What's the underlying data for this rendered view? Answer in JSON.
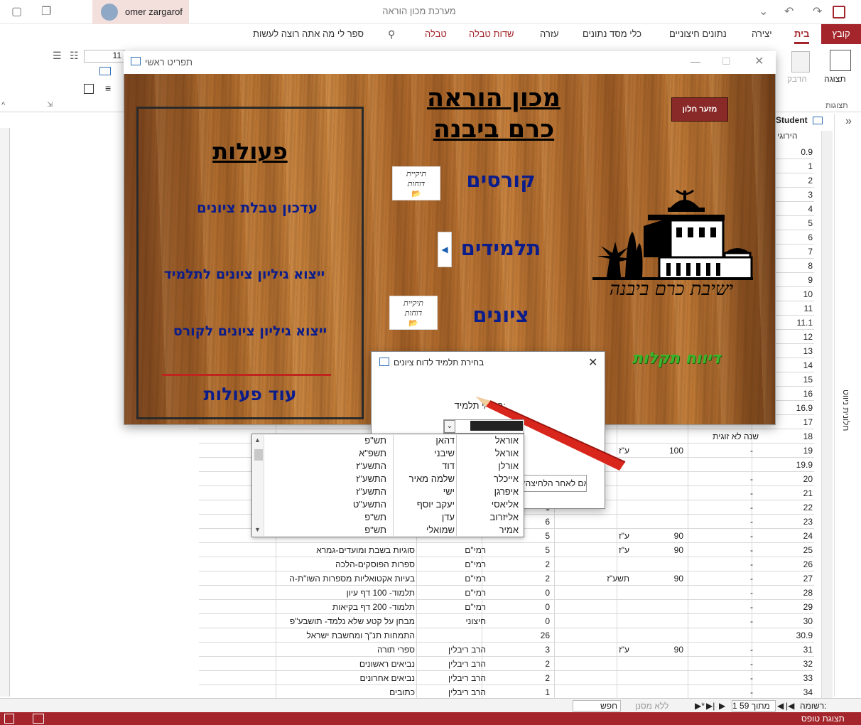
{
  "app": {
    "title": "מערכת מכון הוראה",
    "user": "omer zargarof",
    "file_tab": "קובץ",
    "tabs": [
      "בית",
      "יצירה",
      "נתונים חיצוניים",
      "כלי מסד נתונים",
      "עזרה",
      "שדות טבלה",
      "טבלה"
    ],
    "search_hint": "ספר לי מה אתה רוצה לעשות"
  },
  "ribbon": {
    "views_label": "תצוגה",
    "views_group": "תצוגות",
    "paste_label": "הדבק",
    "font_size": "11"
  },
  "table": {
    "tab_name": "Student",
    "col_head": "הירוגי",
    "rows": [
      {
        "id": "0.9"
      },
      {
        "id": "1"
      },
      {
        "id": "2"
      },
      {
        "id": "3"
      },
      {
        "id": "4"
      },
      {
        "id": "5"
      },
      {
        "id": "6"
      },
      {
        "id": "7"
      },
      {
        "id": "8"
      },
      {
        "id": "9"
      },
      {
        "id": "10"
      },
      {
        "id": "11"
      },
      {
        "id": "11.1"
      },
      {
        "id": "12"
      },
      {
        "id": "13"
      },
      {
        "id": "14"
      },
      {
        "id": "15"
      },
      {
        "id": "16"
      },
      {
        "id": "16.9"
      },
      {
        "id": "17"
      },
      {
        "id": "18",
        "a": "שנה לא זוגית"
      },
      {
        "id": "19",
        "b": "-",
        "c": "100",
        "d": "ע\"ז"
      },
      {
        "id": "19.9"
      },
      {
        "id": "20",
        "b": "-"
      },
      {
        "id": "21",
        "b": "-"
      },
      {
        "id": "22",
        "b": "-",
        "e": "1"
      },
      {
        "id": "23",
        "b": "-",
        "e": "6"
      },
      {
        "id": "24",
        "b": "-",
        "c": "90",
        "d": "ע\"ז",
        "e": "5"
      },
      {
        "id": "25",
        "b": "-",
        "c": "90",
        "d": "ע\"ז",
        "e": "5",
        "f": "רמי\"ם",
        "g": "סוגיות בשבת ומועדים-גמרא"
      },
      {
        "id": "26",
        "b": "-",
        "e": "2",
        "f": "רמי\"ם",
        "g": "ספרות הפוסקים-הלכה"
      },
      {
        "id": "27",
        "b": "-",
        "c": "90",
        "d": "תשע\"ז",
        "e": "2",
        "f": "רמי\"ם",
        "g": "בעיות אקטואליות מספרות השו\"ת-ה"
      },
      {
        "id": "28",
        "b": "-",
        "e": "0",
        "f": "רמי\"ם",
        "g": "תלמוד- 100 דף עיון"
      },
      {
        "id": "29",
        "b": "-",
        "e": "0",
        "f": "רמי\"ם",
        "g": "תלמוד- 200 דף בקיאות"
      },
      {
        "id": "30",
        "b": "-",
        "e": "0",
        "f": "חיצוני",
        "g": "מבחן על קטע שלא נלמד- תושבע\"פ"
      },
      {
        "id": "30.9",
        "e": "26",
        "g": "התמחות תנ\"ך ומחשבת ישראל"
      },
      {
        "id": "31",
        "b": "-",
        "c": "90",
        "d": "ע\"ז",
        "e": "3",
        "f": "הרב ריבלין",
        "g": "ספרי תורה"
      },
      {
        "id": "32",
        "b": "-",
        "e": "2",
        "f": "הרב ריבלין",
        "g": "נביאים ראשונים"
      },
      {
        "id": "33",
        "b": "-",
        "e": "2",
        "f": "הרב ריבלין",
        "g": "נביאים אחרונים"
      },
      {
        "id": "34",
        "b": "-",
        "e": "1",
        "f": "הרב ריבלין",
        "g": "כתובים"
      }
    ]
  },
  "record_nav": {
    "label": "רשומה:",
    "position": "1 מתוך 59",
    "filter": "ללא מסנן",
    "search": "חפש"
  },
  "status": {
    "text": "תצוגת טופס"
  },
  "nav_pane": {
    "label": "חלונית ניווט"
  },
  "form": {
    "title": "תפריט ראשי",
    "actions_title": "פעולות",
    "action_update_grades": "עדכון טבלת ציונים",
    "action_export_student": "ייצוא גיליון ציונים לתלמיד",
    "action_export_course": "ייצוא גיליון ציונים לקורס",
    "more_actions": "עוד פעולות",
    "inst_line1": "מכון הוראה",
    "inst_line2": "כרם ביבנה",
    "courses": "קורסים",
    "students": "תלמידים",
    "grades": "ציונים",
    "folder_label_1": "תיקיית",
    "folder_label_2": "דוחות",
    "minimize": "מזער חלון",
    "yeshiva_name": "ישיבת כרם ביבנה",
    "report_link": "דיווח תקלות"
  },
  "dialog": {
    "title": "בחירת תלמיד לדוח ציונים",
    "label": "בחר/י תלמיד:",
    "button": "*אם לאחר הלחיצה"
  },
  "dropdown": {
    "items": [
      [
        "אוראל",
        "דהאן",
        "תש\"פ"
      ],
      [
        "אוראל",
        "שיבני",
        "תשפ\"א"
      ],
      [
        "אורלן",
        "דוד",
        "התשע\"ז"
      ],
      [
        "אייכלר",
        "שלמה מאיר",
        "התשע\"ז"
      ],
      [
        "איפרגן",
        "ישי",
        "התשע\"ז"
      ],
      [
        "אליאסי",
        "יעקב יוסף",
        "התשע\"ט"
      ],
      [
        "אליזרוב",
        "עדן",
        "תש\"פ"
      ],
      [
        "אמיר",
        "שמואלי",
        "תש\"פ"
      ]
    ]
  }
}
